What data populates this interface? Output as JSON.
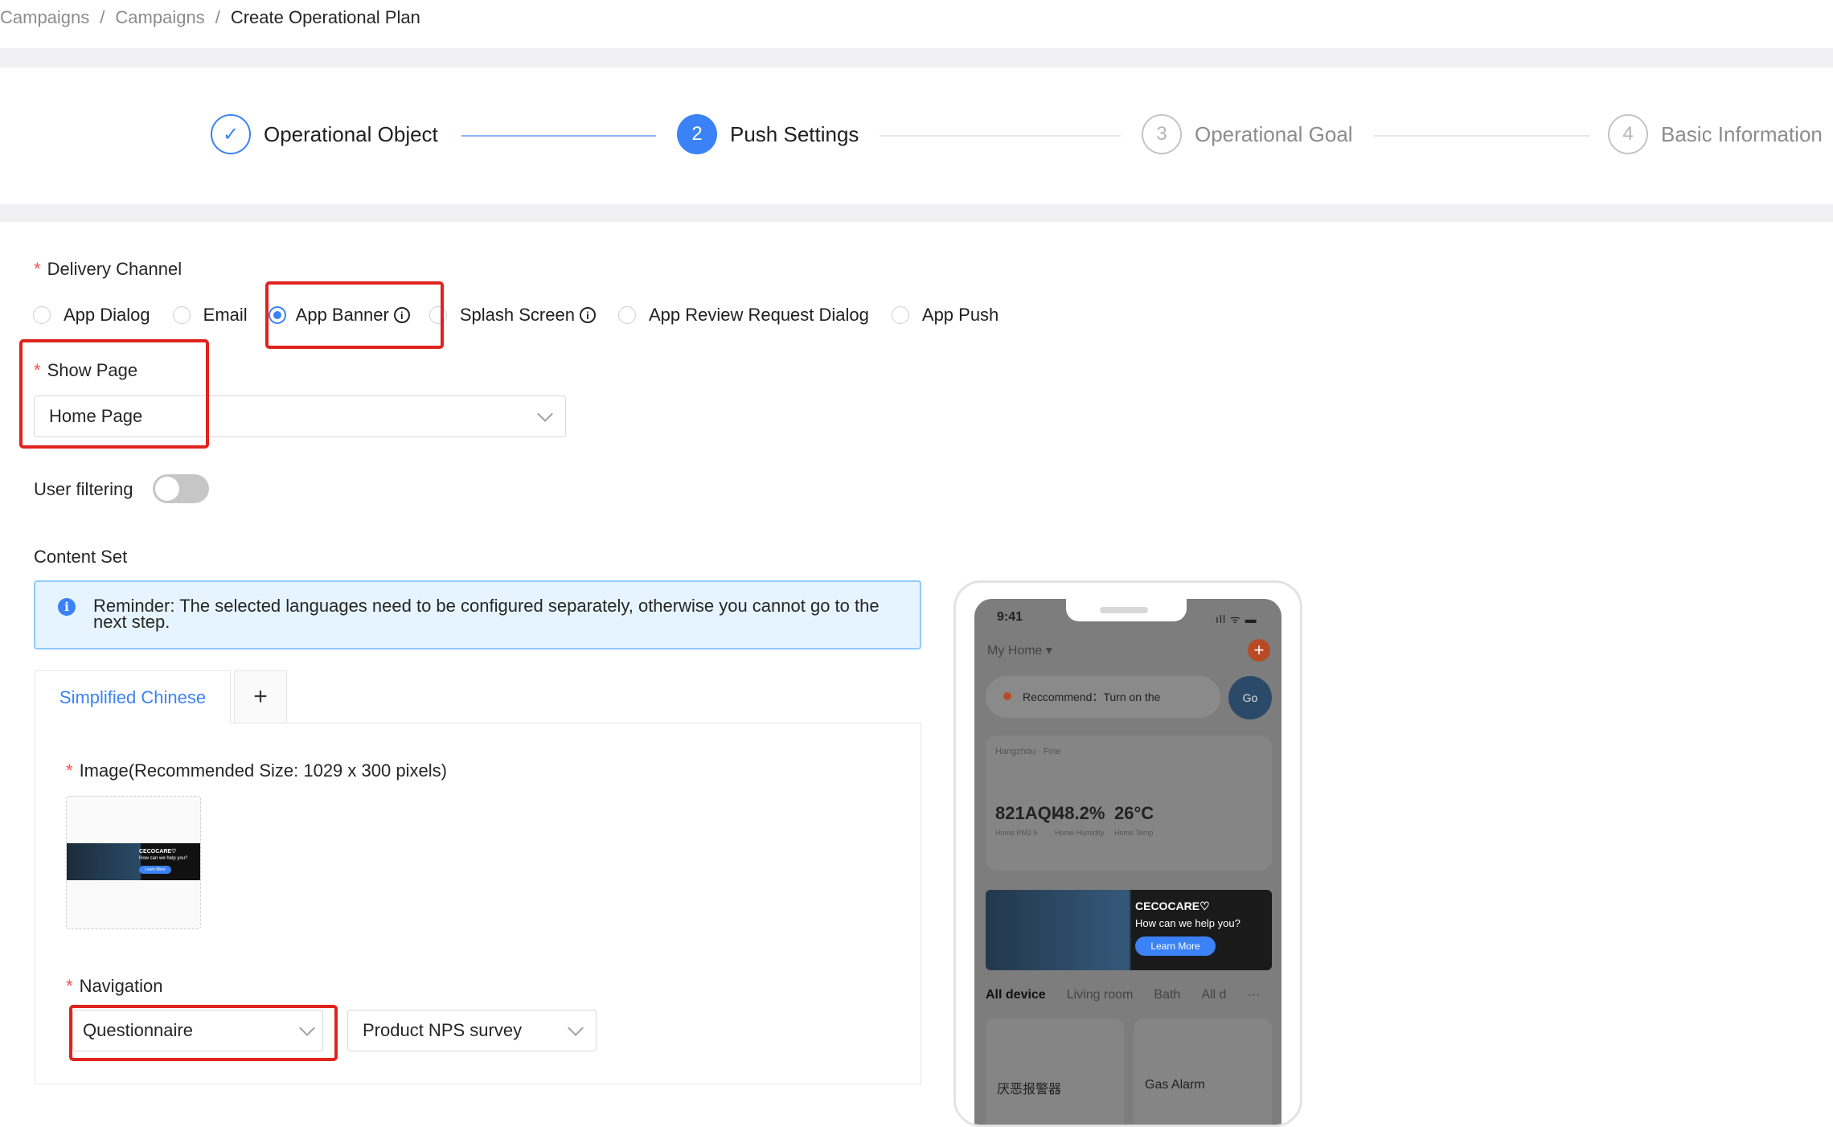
{
  "breadcrumb": [
    "Campaigns",
    "Campaigns",
    "Create Operational Plan"
  ],
  "breadcrumb_sep": "/",
  "steps": [
    {
      "number": "✓",
      "label": "Operational Object",
      "status": "done"
    },
    {
      "number": "2",
      "label": "Push Settings",
      "status": "active"
    },
    {
      "number": "3",
      "label": "Operational Goal",
      "status": "wait"
    },
    {
      "number": "4",
      "label": "Basic Information",
      "status": "wait"
    }
  ],
  "delivery_channel": {
    "label": "Delivery Channel",
    "options": [
      "App Dialog",
      "Email",
      "App Banner",
      "Splash Screen",
      "App Review Request Dialog",
      "App Push"
    ],
    "selected": "App Banner"
  },
  "show_page": {
    "label": "Show Page",
    "value": "Home Page"
  },
  "user_filtering": {
    "label": "User filtering",
    "enabled": false
  },
  "content_set": {
    "label": "Content Set",
    "reminder": "Reminder: The selected languages need to be configured separately, otherwise you cannot go to the next step.",
    "tabs": [
      "Simplified Chinese"
    ],
    "add_tab": "+",
    "image_label": "Image(Recommended Size: 1029 x 300 pixels)",
    "navigation_label": "Navigation",
    "navigation_type": "Questionnaire",
    "navigation_target": "Product NPS survey"
  },
  "banner_preview": {
    "brand": "CECOCARE♡",
    "headline": "How can we help you?",
    "button": "Learn More"
  },
  "phone_preview": {
    "time": "9:41",
    "status_icons": "ıll ᯤ ▬",
    "home": "My Home ▾",
    "plus": "+",
    "recommend": "Reccommend：Turn on the",
    "go": "Go",
    "city": "Hangzhou  ·  Fine",
    "stats": [
      {
        "value": "821AQI",
        "label": "Home PM2.5"
      },
      {
        "value": "48.2%",
        "label": "Home Humidity"
      },
      {
        "value": "26°C",
        "label": "Home Temp"
      }
    ],
    "room_tabs": [
      "All device",
      "Living room",
      "Bath",
      "All d",
      "···"
    ],
    "devices": [
      "厌恶报警器",
      "Gas Alarm"
    ]
  },
  "colors": {
    "accent": "#3b82f6",
    "highlight": "#e0231c",
    "required": "#ff4d4f"
  }
}
